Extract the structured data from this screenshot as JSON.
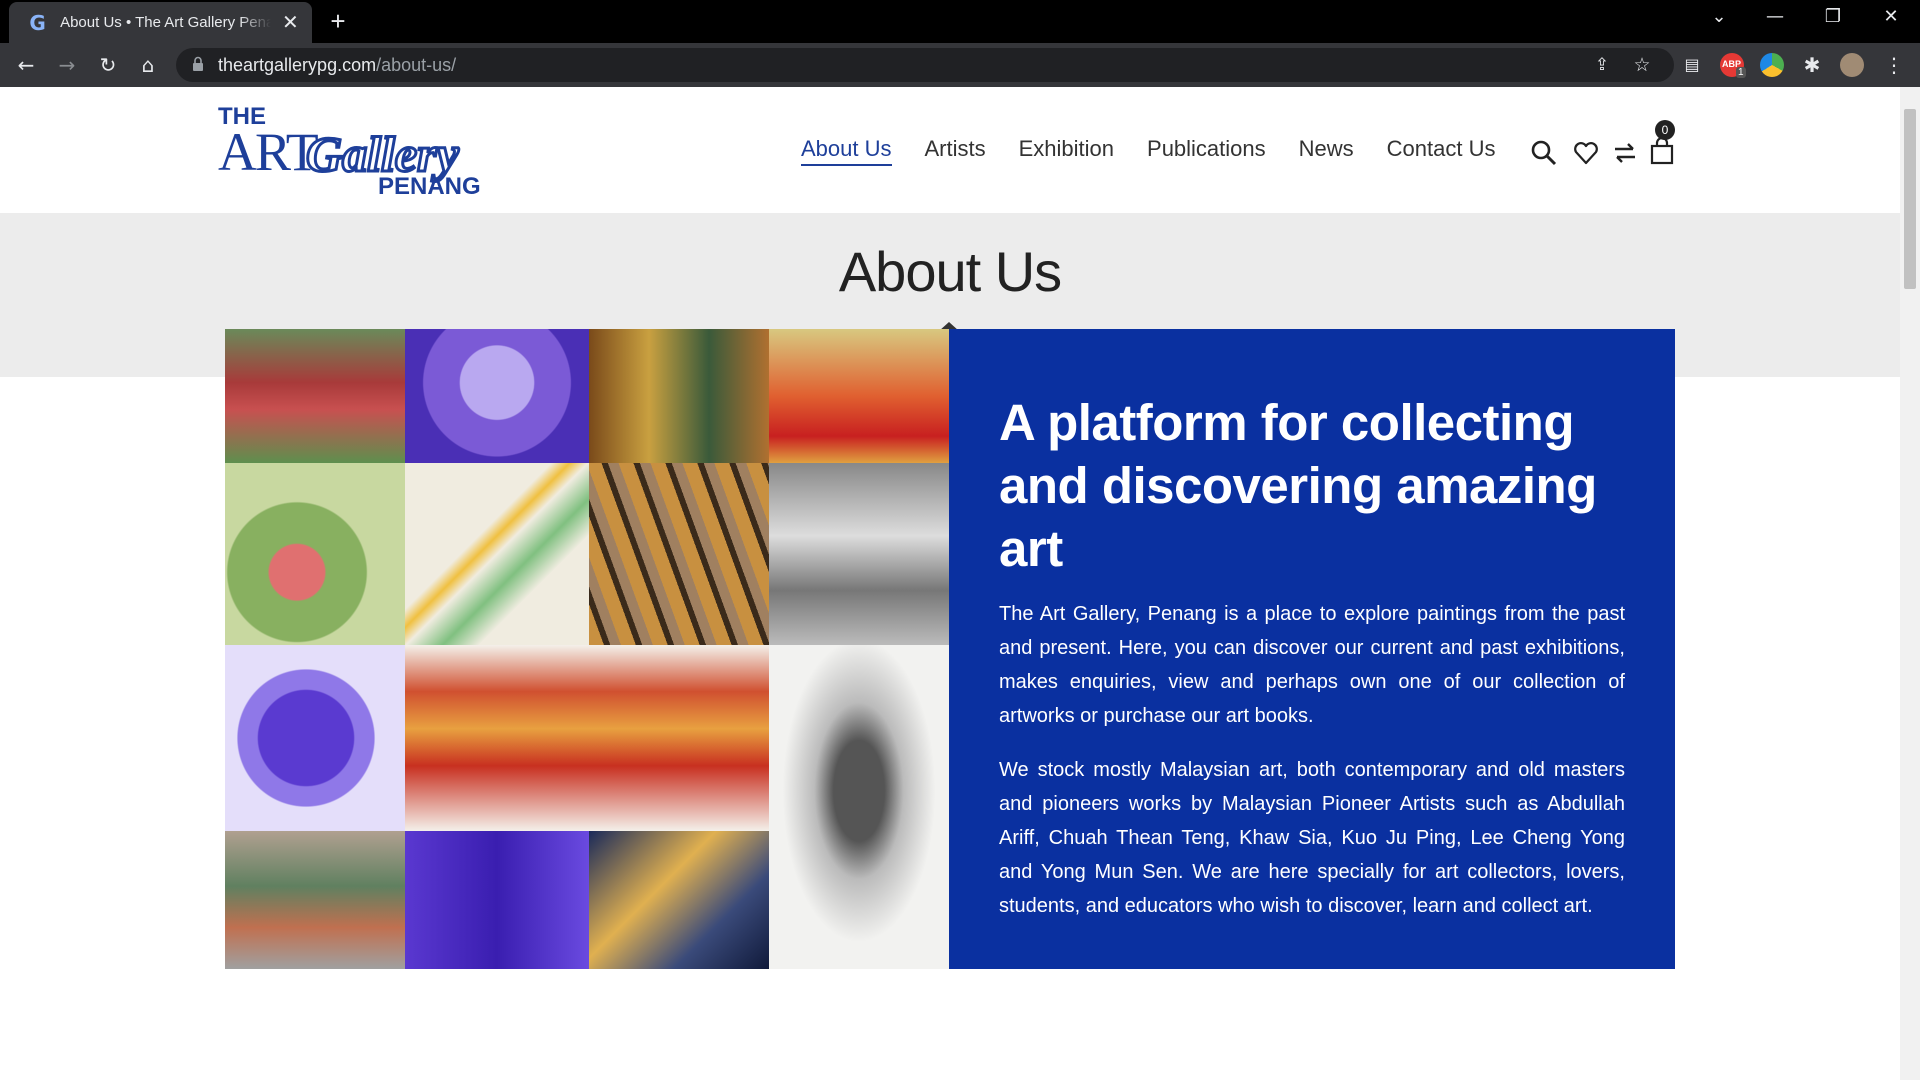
{
  "browser": {
    "tab_title": "About Us • The Art Gallery Penang",
    "url_host": "theartgallerypg.com",
    "url_path": "/about-us/",
    "adblock_badge": "1"
  },
  "logo": {
    "line1": "THE",
    "art": "ART",
    "gallery": "Gallery",
    "penang": "PENANG"
  },
  "nav": {
    "items": [
      "About Us",
      "Artists",
      "Exhibition",
      "Publications",
      "News",
      "Contact Us"
    ],
    "cart_count": "0"
  },
  "banner": {
    "title": "About Us"
  },
  "intro": {
    "heading": "A platform for collecting and discovering amazing art",
    "p1": "The Art Gallery, Penang is a place to explore paintings from the past and present. Here, you can discover our current and past exhibitions, makes enquiries, view and perhaps own one of our collection of artworks or purchase our art books.",
    "p2": "We stock mostly Malaysian art, both contemporary and old masters and pioneers works by Malaysian Pioneer Artists such as Abdullah Ariff, Chuah Thean Teng, Khaw Sia, Kuo Ju Ping, Lee Cheng Yong and Yong Mun Sen. We are here specially for art collectors, lovers, students, and educators who wish to discover, learn and collect art."
  },
  "colors": {
    "brand_blue": "#1e3f9a",
    "panel_blue": "#0a30a0",
    "banner_gray": "#ececec"
  }
}
